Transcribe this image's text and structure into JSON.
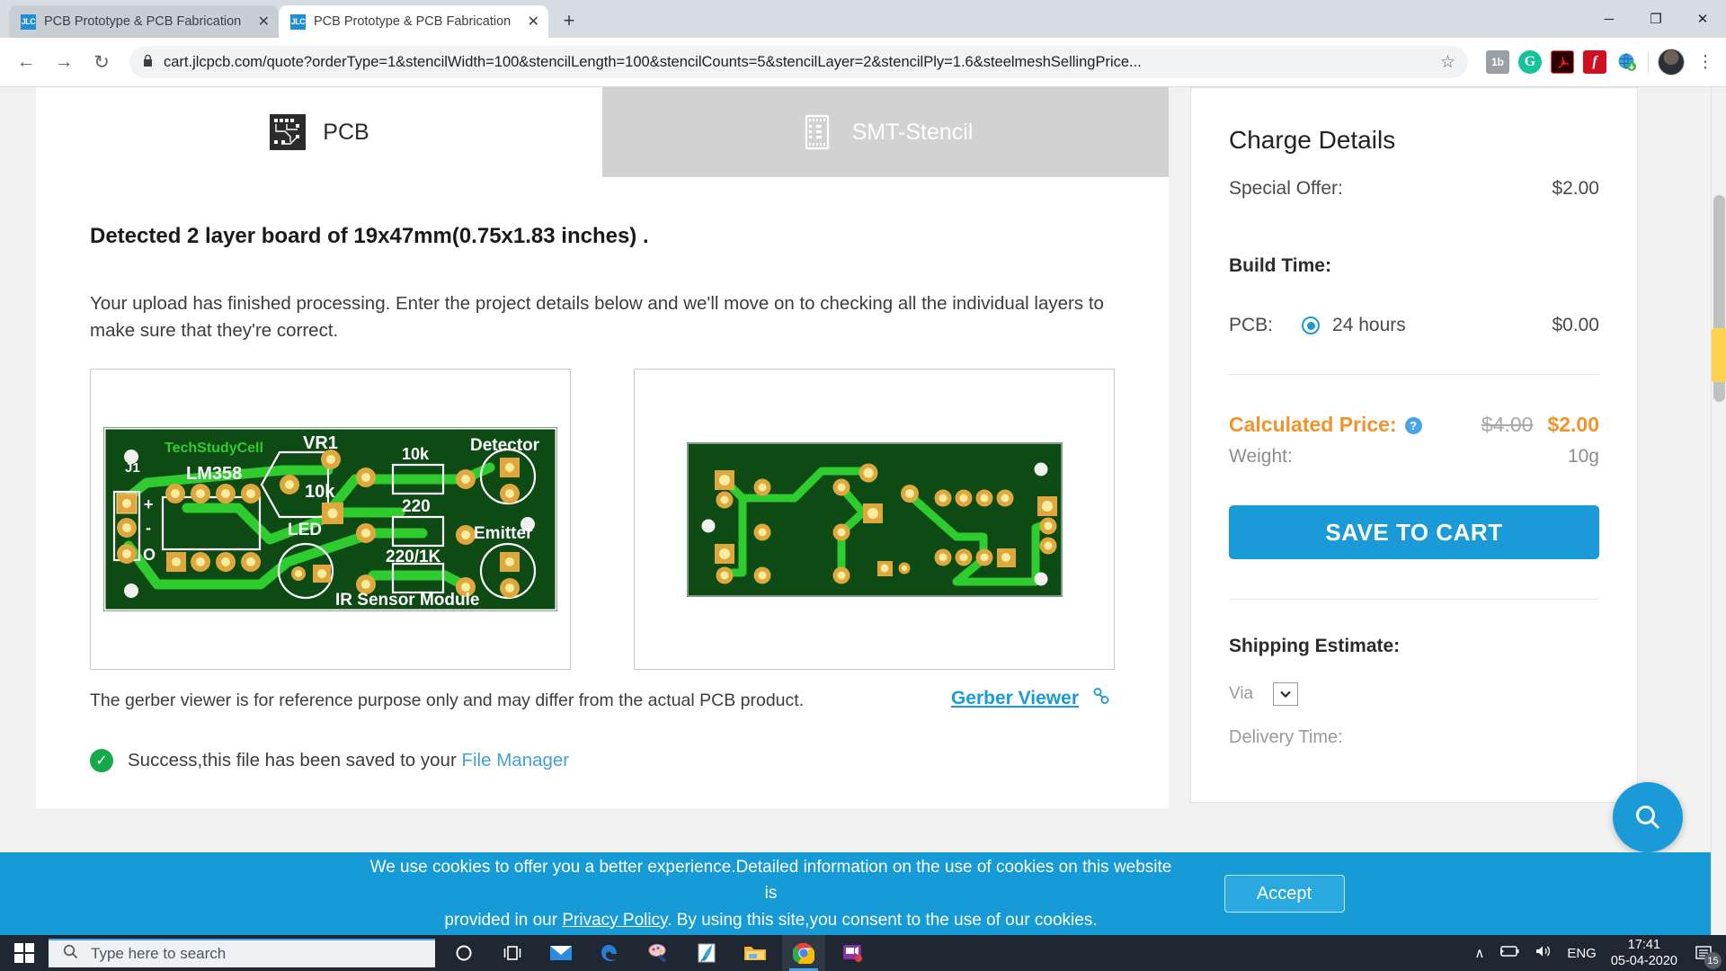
{
  "browser": {
    "tabs": [
      {
        "favicon": "JLC",
        "title": "PCB Prototype & PCB Fabrication",
        "close": "✕"
      },
      {
        "favicon": "JLC",
        "title": "PCB Prototype & PCB Fabrication",
        "close": "✕"
      }
    ],
    "new_tab_label": "+",
    "window_controls": {
      "minimize": "─",
      "maximize": "❐",
      "close": "✕"
    },
    "nav": {
      "back": "←",
      "forward": "→",
      "reload": "↻"
    },
    "omnibox": {
      "lock": "🔒",
      "url": "cart.jlcpcb.com/quote?orderType=1&stencilWidth=100&stencilLength=100&stencilCounts=5&stencilLayer=2&stencilPly=1.6&steelmeshSellingPrice...",
      "star": "☆"
    },
    "extensions": [
      {
        "name": "lastpass-extension",
        "label": "1b"
      },
      {
        "name": "grammarly-extension",
        "label": "G"
      },
      {
        "name": "adobe-acrobat-extension",
        "label": "ᴀ"
      },
      {
        "name": "flash-player-extension",
        "label": "f"
      },
      {
        "name": "idm-extension",
        "label": "🌎"
      }
    ],
    "kebab": "⋮"
  },
  "product_tabs": [
    {
      "label": "PCB",
      "active": true
    },
    {
      "label": "SMT-Stencil",
      "active": false
    }
  ],
  "main": {
    "detected_heading": "Detected 2 layer board of 19x47mm(0.75x1.83 inches) .",
    "processing_text": "Your upload has finished processing. Enter the project details below and we'll move on to checking all the individual layers to make sure that they're correct.",
    "gerber_note": "The gerber viewer is for reference purpose only and may differ from the actual PCB product.",
    "gerber_viewer_link": "Gerber Viewer",
    "chain_icon": "⚭",
    "success_check": "✓",
    "success_text_before": "Success,this file has been saved to your ",
    "file_manager_link": "File Manager"
  },
  "pcb_preview": {
    "top_layer_labels": [
      "TechStudyCell",
      "VR1",
      "10k",
      "Detector",
      "LM358",
      "10k",
      "220",
      "LED",
      "Emitter",
      "220/1K",
      "IR Sensor Module",
      "J1",
      "+",
      "-",
      "O"
    ],
    "colors": {
      "board": "#0d4a14",
      "trace": "#2ecc2e",
      "pad_gold": "#e8b84b",
      "pad_center": "#f5e07a",
      "silkscreen": "#ffffff",
      "logo_text": "#2ecc2e"
    }
  },
  "charge_details": {
    "title": "Charge Details",
    "special_offer_label": "Special Offer:",
    "special_offer_value": "$2.00",
    "build_time_label": "Build Time:",
    "pcb_label": "PCB:",
    "build_time_option": "24 hours",
    "build_time_price": "$0.00",
    "calculated_price_label": "Calculated Price:",
    "help_icon": "?",
    "old_price": "$4.00",
    "new_price": "$2.00",
    "weight_label": "Weight:",
    "weight_value": "10g",
    "save_to_cart": "SAVE TO CART",
    "shipping_estimate_label": "Shipping Estimate:",
    "via_label": "Via",
    "via_caret": "⌄",
    "delivery_time_label": "Delivery Time:",
    "accent_blue": "#1a9bd7",
    "accent_orange": "#f0932b"
  },
  "cookie_banner": {
    "line1_a": "We use cookies to offer you a better experience.Detailed information on the use of cookies on this website is",
    "line2_a": "provided in our ",
    "privacy_policy": "Privacy Policy",
    "line2_b": ". By using this site,you consent to the use of our cookies.",
    "accept_label": "Accept"
  },
  "floating_button": {
    "icon": "🔍"
  },
  "taskbar": {
    "search_placeholder": "Type here to search",
    "search_icon": "⚲",
    "apps": [
      {
        "name": "cortana",
        "glyph": "○"
      },
      {
        "name": "task-view",
        "glyph": "☰"
      },
      {
        "name": "mail",
        "glyph": "✉"
      },
      {
        "name": "edge",
        "glyph": "e"
      },
      {
        "name": "paint",
        "glyph": "✎"
      },
      {
        "name": "notepad-plus",
        "glyph": "🖋"
      },
      {
        "name": "file-explorer",
        "glyph": "🗀"
      },
      {
        "name": "chrome",
        "glyph": "●"
      },
      {
        "name": "screen-recorder",
        "glyph": "🎥"
      }
    ],
    "tray": {
      "chevron": "∧",
      "battery": "🔋",
      "volume": "🔊",
      "language": "ENG",
      "time": "17:41",
      "date": "05-04-2020",
      "notification_icon": "☰",
      "notification_count": "15"
    }
  }
}
